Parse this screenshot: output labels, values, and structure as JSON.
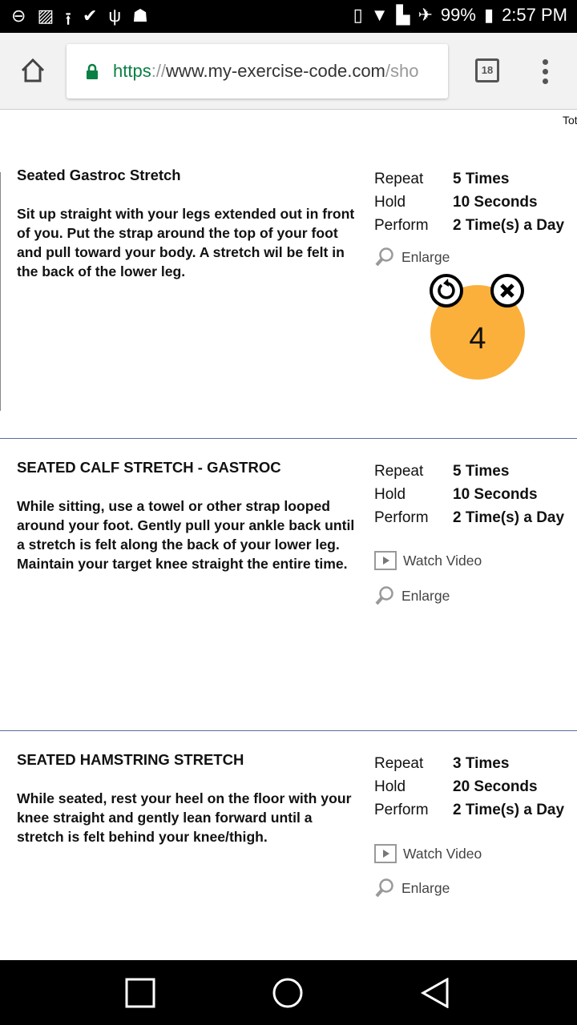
{
  "status_bar": {
    "battery": "99%",
    "time": "2:57 PM",
    "icons": [
      "dnd-icon",
      "image-icon",
      "upload-icon",
      "download-done-icon",
      "usb-icon",
      "android-icon",
      "vibrate-icon",
      "wifi-icon",
      "sim-error-icon",
      "airplane-icon",
      "battery-charging-icon"
    ]
  },
  "browser": {
    "url_scheme": "https",
    "url_sep": "://",
    "url_domain": "www.my-exercise-code.com",
    "url_path": "/sho",
    "tab_count": "18"
  },
  "header_cut_text": "Tot",
  "exercises": [
    {
      "title": "Seated Gastroc Stretch",
      "description": "Sit up straight with your legs extended out in front of you. Put the strap around the top of your foot and pull toward your body. A stretch wil be felt in the back of the lower leg.",
      "repeat_label": "Repeat",
      "repeat": "5 Times",
      "hold_label": "Hold",
      "hold": "10 Seconds",
      "perform_label": "Perform",
      "perform": "2 Time(s) a Day",
      "enlarge": "Enlarge"
    },
    {
      "title": "SEATED CALF STRETCH - GASTROC",
      "description": "While sitting, use a towel or other strap looped around your foot. Gently pull your ankle back until a stretch is felt along the back of your lower leg. Maintain your target knee straight the entire time.",
      "repeat_label": "Repeat",
      "repeat": "5 Times",
      "hold_label": "Hold",
      "hold": "10 Seconds",
      "perform_label": "Perform",
      "perform": "2 Time(s) a Day",
      "video": "Watch Video",
      "enlarge": "Enlarge"
    },
    {
      "title": "SEATED HAMSTRING STRETCH",
      "description": "While seated, rest your heel on the floor with your knee straight and gently lean forward until a stretch is felt behind your knee/thigh.",
      "repeat_label": "Repeat",
      "repeat": "3 Times",
      "hold_label": "Hold",
      "hold": "20 Seconds",
      "perform_label": "Perform",
      "perform": "2 Time(s) a Day",
      "video": "Watch Video",
      "enlarge": "Enlarge"
    }
  ],
  "timer": {
    "count": "4",
    "color": "#fbb03b"
  }
}
